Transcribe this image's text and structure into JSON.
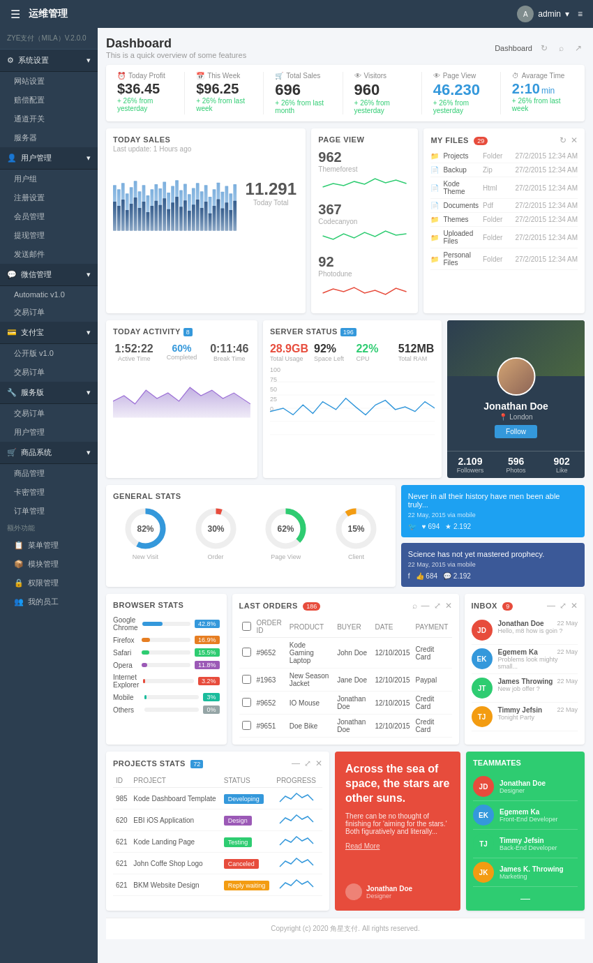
{
  "app": {
    "title": "运维管理",
    "version": "ZYE支付（MILA）V.2.0.0",
    "admin_label": "admin",
    "menu_icon": "☰"
  },
  "sidebar": {
    "system_settings": "系统设置",
    "items_system": [
      "网站设置",
      "赔偿配置",
      "通道开关",
      "服务器"
    ],
    "user_mgmt": "用户管理",
    "items_user": [
      "用户组",
      "注册设置",
      "会员管理",
      "提现管理",
      "发送邮件"
    ],
    "wechat": "微信管理",
    "items_wechat": [
      "Automatic v1.0",
      "交易订单"
    ],
    "alipay": "支付宝",
    "items_alipay": [
      "公开版 v1.0",
      "交易订单"
    ],
    "service": "服务版",
    "items_service": [
      "交易订单",
      "用户管理"
    ],
    "shop": "商品系统",
    "items_shop": [
      "商品管理",
      "卡密管理",
      "订单管理"
    ],
    "extra": "额外功能",
    "items_extra": [
      "菜单管理",
      "模块管理",
      "权限管理",
      "我的员工"
    ]
  },
  "header": {
    "title": "Dashboard",
    "subtitle": "This is a quick overview of some features",
    "breadcrumb": "Dashboard",
    "refresh_icon": "↻",
    "search_icon": "⌕",
    "chart_icon": "↗"
  },
  "stats": {
    "today_profit_label": "Today Profit",
    "today_profit_value": "$36.45",
    "today_profit_change": "+ 26% from yesterday",
    "this_week_label": "This Week",
    "this_week_value": "$96.25",
    "this_week_change": "+ 26% from last week",
    "total_sales_label": "Total Sales",
    "total_sales_value": "696",
    "total_sales_change": "+ 26% from last month",
    "visitors_label": "Visitors",
    "visitors_value": "960",
    "visitors_change": "+ 26% from yesterday",
    "page_view_label": "Page View",
    "page_view_value": "46.230",
    "page_view_change": "+ 26% from yesterday",
    "avg_time_label": "Avarage Time",
    "avg_time_value": "2:10",
    "avg_time_unit": "min",
    "avg_time_change": "+ 26% from last week"
  },
  "today_sales": {
    "title": "TODAY SALES",
    "subtitle": "Last update: 1 Hours ago",
    "total_number": "11.291",
    "total_label": "Today Total"
  },
  "page_view": {
    "title": "PAGE VIEW",
    "items": [
      {
        "number": "962",
        "source": "Themeforest"
      },
      {
        "number": "367",
        "source": "Codecanyon"
      },
      {
        "number": "92",
        "source": "Photodune"
      }
    ]
  },
  "my_files": {
    "title": "MY FILES",
    "badge": "29",
    "files": [
      {
        "name": "Projects",
        "type": "Folder",
        "date": "27/2/2015 12:34 AM"
      },
      {
        "name": "Backup",
        "type": "Zip",
        "date": "27/2/2015 12:34 AM"
      },
      {
        "name": "Kode Theme",
        "type": "Html",
        "date": "27/2/2015 12:34 AM"
      },
      {
        "name": "Documents",
        "type": "Pdf",
        "date": "27/2/2015 12:34 AM"
      },
      {
        "name": "Themes",
        "type": "Folder",
        "date": "27/2/2015 12:34 AM"
      },
      {
        "name": "Uploaded Files",
        "type": "Folder",
        "date": "27/2/2015 12:34 AM"
      },
      {
        "name": "Personal Files",
        "type": "Folder",
        "date": "27/2/2015 12:34 AM"
      }
    ]
  },
  "today_activity": {
    "title": "TODAY ACTIVITY",
    "badge": "8",
    "active_time": "1:52:22",
    "active_label": "Active Time",
    "completed_pct": "60%",
    "completed_label": "Completed",
    "break_time": "0:11:46",
    "break_label": "Break Time"
  },
  "server_status": {
    "title": "SERVER STATUS",
    "badge": "196",
    "total_usage": "28.9GB",
    "total_usage_label": "Total Usage",
    "space_left": "92%",
    "space_left_label": "Space Left",
    "cpu": "22%",
    "cpu_label": "CPU",
    "total_ram": "512MB",
    "total_ram_label": "Total RAM"
  },
  "profile": {
    "name": "Jonathan Doe",
    "location": "London",
    "follow_label": "Follow",
    "followers": "2.109",
    "followers_label": "Followers",
    "photos": "596",
    "photos_label": "Photos",
    "likes": "902",
    "likes_label": "Like"
  },
  "general_stats": {
    "title": "GENERAL STATS",
    "items": [
      {
        "pct": "82%",
        "label": "New Visit",
        "value": 82
      },
      {
        "pct": "30%",
        "label": "Order",
        "value": 30
      },
      {
        "pct": "62%",
        "label": "Page View",
        "value": 62
      },
      {
        "pct": "15%",
        "label": "Client",
        "value": 15
      }
    ]
  },
  "social": {
    "twitter": {
      "quote": "Never in all their history have men been able truly...",
      "date": "22 May, 2015 via mobile",
      "likes": "694",
      "stars": "2.192"
    },
    "facebook": {
      "quote": "Science has not yet mastered prophecy.",
      "date": "22 May, 2015 via mobile",
      "likes": "684",
      "comments": "2.192"
    }
  },
  "browser_stats": {
    "title": "BROWSER STATS",
    "browsers": [
      {
        "name": "Google Chrome",
        "pct": "42.8%",
        "value": 42.8,
        "color": "#3498db"
      },
      {
        "name": "Firefox",
        "pct": "16.9%",
        "value": 16.9,
        "color": "#e67e22"
      },
      {
        "name": "Safari",
        "pct": "15.5%",
        "value": 15.5,
        "color": "#2ecc71"
      },
      {
        "name": "Opera",
        "pct": "11.8%",
        "value": 11.8,
        "color": "#9b59b6"
      },
      {
        "name": "Internet Explorer",
        "pct": "3.2%",
        "value": 3.2,
        "color": "#e74c3c"
      },
      {
        "name": "Mobile",
        "pct": "3%",
        "value": 3,
        "color": "#1abc9c"
      },
      {
        "name": "Others",
        "pct": "0%",
        "value": 0,
        "color": "#95a5a6"
      }
    ]
  },
  "last_orders": {
    "title": "LAST ORDERS",
    "badge": "186",
    "columns": [
      "ORDER ID",
      "PRODUCT",
      "BUYER",
      "DATE",
      "PAYMENT"
    ],
    "orders": [
      {
        "id": "#9652",
        "product": "Kode Gaming Laptop",
        "buyer": "John Doe",
        "date": "12/10/2015",
        "payment": "Credit Card"
      },
      {
        "id": "#1963",
        "product": "New Season Jacket",
        "buyer": "Jane Doe",
        "date": "12/10/2015",
        "payment": "Paypal"
      },
      {
        "id": "#9652",
        "product": "IO Mouse",
        "buyer": "Jonathan Doe",
        "date": "12/10/2015",
        "payment": "Credit Card"
      },
      {
        "id": "#9651",
        "product": "Doe Bike",
        "buyer": "Jonathan Doe",
        "date": "12/10/2015",
        "payment": "Credit Card"
      }
    ]
  },
  "inbox": {
    "title": "INBOX",
    "badge": "9",
    "messages": [
      {
        "name": "Jonathan Doe",
        "msg": "Hello, m8 how is goin ?",
        "time": "22 May",
        "color": "#e74c3c"
      },
      {
        "name": "Egemem Ka",
        "msg": "Problems look mighty small...",
        "time": "22 May",
        "color": "#3498db"
      },
      {
        "name": "James Throwing",
        "msg": "New job offer ?",
        "time": "22 May",
        "color": "#2ecc71"
      },
      {
        "name": "Timmy Jefsin",
        "msg": "Tonight Party",
        "time": "22 May",
        "color": "#f39c12"
      }
    ]
  },
  "projects_stats": {
    "title": "PROJECTS STATS",
    "badge": "72",
    "columns": [
      "ID",
      "PROJECT",
      "STATUS",
      "PROGRESS"
    ],
    "projects": [
      {
        "id": "985",
        "name": "Kode Dashboard Template",
        "status": "Developing",
        "status_class": "developing"
      },
      {
        "id": "620",
        "name": "EBI iOS Application",
        "status": "Design",
        "status_class": "design"
      },
      {
        "id": "621",
        "name": "Kode Landing Page",
        "status": "Testing",
        "status_class": "testing"
      },
      {
        "id": "621",
        "name": "John Coffe Shop Logo",
        "status": "Canceled",
        "status_class": "cancelled"
      },
      {
        "id": "621",
        "name": "BKM Website Design",
        "status": "Reply waiting",
        "status_class": "reply"
      }
    ]
  },
  "blog": {
    "quote": "Across the sea of space, the stars are other suns.",
    "text": "There can be no thought of finishing for 'aiming for the stars.' Both figuratively and literally...",
    "read_more": "Read More",
    "author_name": "Jonathan Doe",
    "author_role": "Designer"
  },
  "teammates": {
    "title": "TEAMMATES",
    "members": [
      {
        "name": "Jonathan Doe",
        "role": "Designer",
        "color": "#e74c3c"
      },
      {
        "name": "Egemem Ka",
        "role": "Front-End Developer",
        "color": "#3498db"
      },
      {
        "name": "Timmy Jefsin",
        "role": "Back-End Developer",
        "color": "#2ecc71"
      },
      {
        "name": "James K. Throwing",
        "role": "Marketing",
        "color": "#f39c12"
      }
    ]
  },
  "footer": {
    "text": "Copyright (c) 2020 角星支付. All rights reserved."
  }
}
